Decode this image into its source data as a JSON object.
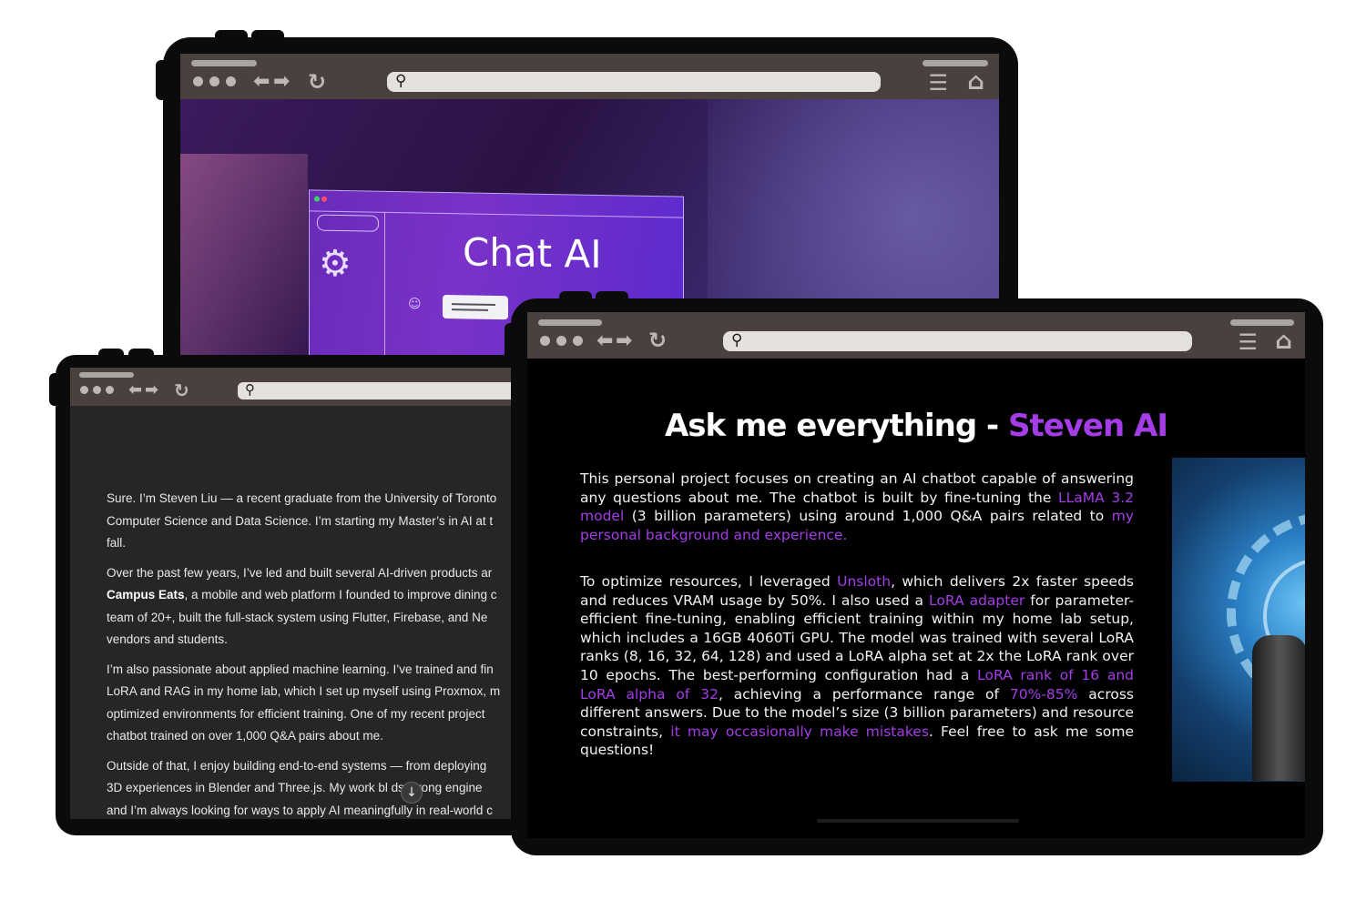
{
  "colors": {
    "accent": "#a43de6",
    "frame": "#0b0b0b",
    "chrome": "#4a403e",
    "urlbar": "#e4e1dd"
  },
  "back_window": {
    "content": {
      "title": "Chat AI"
    }
  },
  "left_window": {
    "paragraphs": [
      {
        "lines": [
          "Sure. I’m Steven Liu — a recent graduate from the University of Toronto",
          "Computer Science and Data Science. I’m starting my Master’s in AI at t",
          "fall."
        ]
      },
      {
        "lines_html": true,
        "lines": [
          "Over the past few years, I’ve led and built several AI-driven products ar",
          "Campus Eats, a mobile and web platform I founded to improve dining c",
          "team of 20+, built the full-stack system using Flutter, Firebase, and Ne",
          "vendors and students."
        ],
        "bold_prefix": "Campus Eats"
      },
      {
        "lines": [
          "I’m also passionate about applied machine learning. I’ve trained and fin",
          "LoRA and RAG in my home lab, which I set up myself using Proxmox, m",
          "optimized environments for efficient training. One of my recent project",
          "chatbot trained on over 1,000 Q&A pairs about me."
        ]
      },
      {
        "lines": [
          "Outside of that, I enjoy building end-to-end systems — from deploying",
          "3D experiences in Blender and Three.js. My work bl    ds strong engine",
          "and I’m always looking for ways to apply AI meaningfully in real-world c"
        ]
      }
    ],
    "scroll_hint_icon": "arrow-down-icon"
  },
  "front_window": {
    "heading_plain": "Ask me everything - ",
    "heading_accent": "Steven AI",
    "para1": {
      "t1": "This personal project focuses on creating an AI chatbot capable of answering any questions about me. The chatbot is built by fine-tuning the ",
      "l1": "LLaMA 3.2 model",
      "t2": " (3 billion parameters) using around 1,000 Q&A pairs related to ",
      "l2": "my personal background and experience."
    },
    "para2": {
      "t1": "To optimize resources, I leveraged ",
      "l1": "Unsloth",
      "t2": ", which delivers 2x faster speeds and reduces VRAM usage by 50%. I also used a ",
      "l2": "LoRA adapter",
      "t3": " for parameter-efficient fine-tuning, enabling efficient training within my home lab setup, which includes a 16GB 4060Ti GPU. The model was trained with several LoRA ranks (8, 16, 32, 64, 128) and used a LoRA alpha set at 2x the LoRA rank over 10 epochs. The best-performing configuration had a ",
      "l3": "LoRA rank of 16 and LoRA alpha of 32",
      "t4": ", achieving a performance range of ",
      "l4": "70%-85%",
      "t5": " across different answers. Due to the model’s size (3 billion parameters) and resource constraints, ",
      "l5": "it may occasionally make mistakes",
      "t6": ". Feel free to ask me some questions!"
    }
  },
  "icons": {
    "search": "search-icon",
    "back": "back-arrow-icon",
    "forward": "forward-arrow-icon",
    "reload": "reload-icon",
    "menu": "menu-icon",
    "home": "home-icon",
    "window_dots": "window-dots-icon"
  }
}
